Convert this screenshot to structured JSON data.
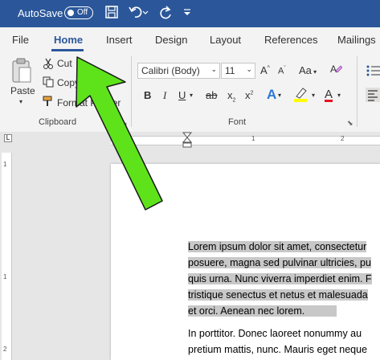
{
  "titlebar": {
    "autosave_label": "AutoSave",
    "toggle_text": "Off",
    "color": "#2b579a"
  },
  "tabs": [
    {
      "label": "File"
    },
    {
      "label": "Home",
      "active": true
    },
    {
      "label": "Insert"
    },
    {
      "label": "Design"
    },
    {
      "label": "Layout"
    },
    {
      "label": "References"
    },
    {
      "label": "Mailings"
    }
  ],
  "clipboard": {
    "paste_label": "Paste",
    "cut_label": "Cut",
    "copy_label": "Copy",
    "format_painter_label": "Format Painter",
    "group_label": "Clipboard"
  },
  "font": {
    "font_name": "Calibri (Body)",
    "font_size": "11",
    "grow_label": "A",
    "shrink_label": "A",
    "case_label": "Aa",
    "bold_label": "B",
    "italic_label": "I",
    "underline_label": "U",
    "strike_label": "ab",
    "subscript_label": "x",
    "superscript_label": "x",
    "effects_label": "A",
    "highlight_label": "ab",
    "font_color_label": "A",
    "group_label": "Font"
  },
  "ruler": {
    "h_numbers": [
      "1",
      "1",
      "2"
    ],
    "v_numbers": [
      "1",
      "1",
      "2"
    ]
  },
  "document": {
    "highlighted_lines": [
      "Lorem ipsum dolor sit amet, consectetur",
      "posuere, magna sed pulvinar ultricies, pu",
      "quis urna. Nunc viverra imperdiet enim. F",
      "tristique senectus et netus et malesuada",
      "et orci. Aenean nec lorem."
    ],
    "lines": [
      "In porttitor. Donec laoreet nonummy au",
      "pretium mattis, nunc. Mauris eget neque"
    ]
  },
  "annotation": {
    "arrow_color": "#5ee31b"
  }
}
